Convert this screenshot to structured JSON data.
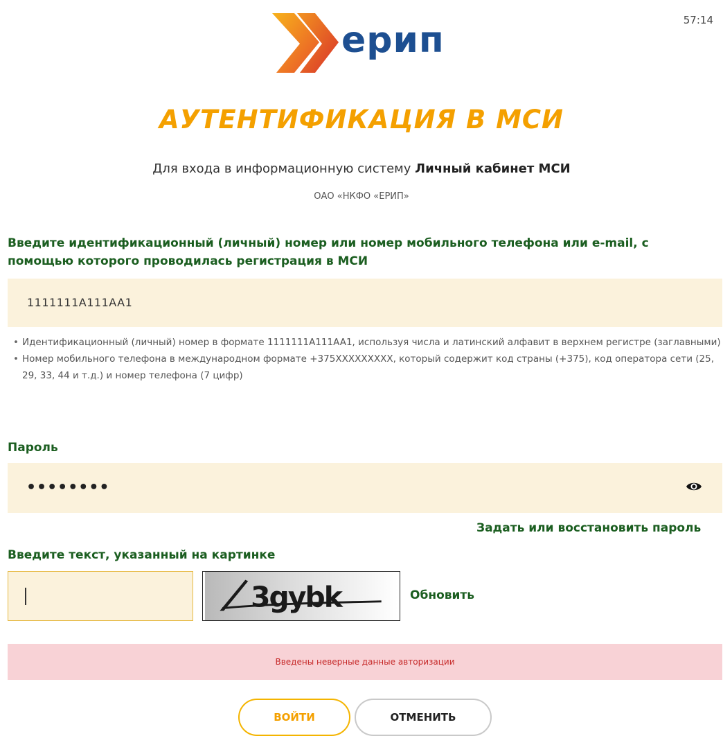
{
  "header": {
    "timer": "57:14",
    "logo_text": "ерип"
  },
  "page": {
    "title": "АУТЕНТИФИКАЦИЯ В МСИ",
    "subtitle_prefix": "Для входа в информационную систему",
    "subtitle_bold": "Личный кабинет МСИ",
    "org": "ОАО «НКФО «ЕРИП»"
  },
  "login_field": {
    "label": "Введите идентификационный (личный) номер или номер мобильного телефона или e-mail, с помощью которого проводилась регистрация в МСИ",
    "value": "1111111A111AA1",
    "hints": [
      "Идентификационный (личный) номер в формате 1111111A111AA1, используя числа и латинский алфавит в верхнем регистре (заглавными)",
      "Номер мобильного телефона в международном формате +375XXXXXXXXX, который содержит код страны (+375), код оператора сети (25, 29, 33, 44 и т.д.) и номер телефона (7 цифр)"
    ]
  },
  "password_field": {
    "label": "Пароль",
    "masked_value": "••••••••",
    "toggle_icon": "eye-icon",
    "forgot_link": "Задать или восстановить пароль"
  },
  "captcha": {
    "label": "Введите текст, указанный на картинке",
    "value": "",
    "image_text": "3gybk",
    "refresh_label": "Обновить"
  },
  "error": {
    "message": "Введены неверные данные авторизации"
  },
  "buttons": {
    "login": "ВОЙТИ",
    "cancel": "ОТМЕНИТЬ"
  },
  "colors": {
    "accent": "#f4a000",
    "label_green": "#1b5e20",
    "input_bg": "#fbf2dc",
    "error_bg": "#f8d2d6",
    "error_text": "#c62828",
    "logo_blue": "#1d4f91"
  }
}
